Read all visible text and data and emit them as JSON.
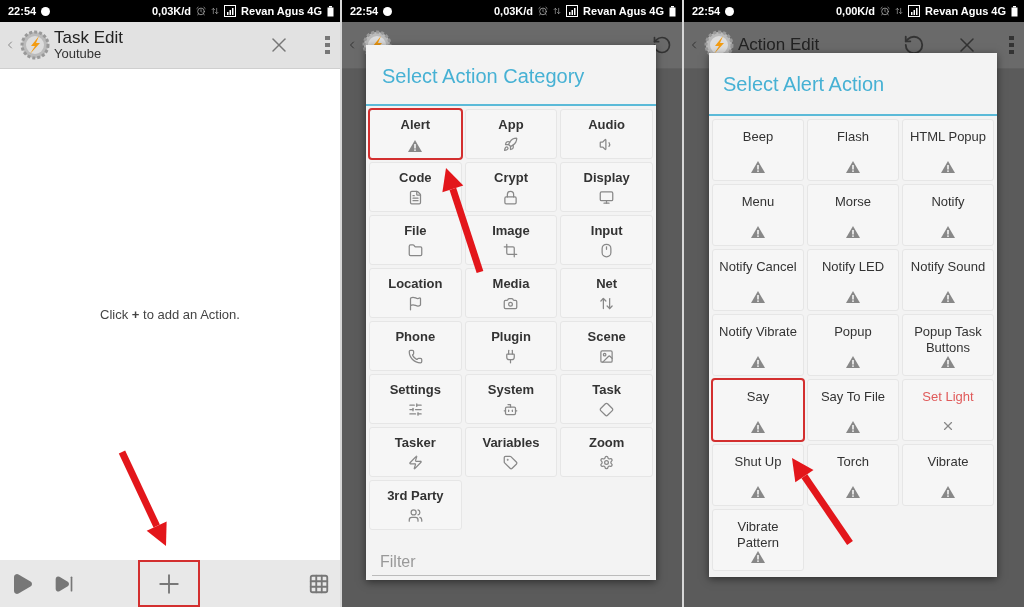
{
  "task_edit": {
    "status_bar": {
      "time": "22:54",
      "speed": "0,03K/d",
      "carrier": "Revan Agus 4G"
    },
    "title": "Task Edit",
    "subtitle": "Youtube",
    "message": "Click **+** to add an Action.",
    "add_highlighted": true
  },
  "category_dialog": {
    "status_bar": {
      "time": "22:54",
      "speed": "0,03K/d",
      "carrier": "Revan Agus 4G"
    },
    "title": "Select Action Category",
    "categories": [
      {
        "label": "Alert",
        "highlighted": true
      },
      {
        "label": "App",
        "highlighted": false
      },
      {
        "label": "Audio",
        "highlighted": false
      },
      {
        "label": "Code",
        "highlighted": false
      },
      {
        "label": "Crypt",
        "highlighted": false
      },
      {
        "label": "Display",
        "highlighted": false
      },
      {
        "label": "File",
        "highlighted": false
      },
      {
        "label": "Image",
        "highlighted": false
      },
      {
        "label": "Input",
        "highlighted": false
      },
      {
        "label": "Location",
        "highlighted": false
      },
      {
        "label": "Media",
        "highlighted": false
      },
      {
        "label": "Net",
        "highlighted": false
      },
      {
        "label": "Phone",
        "highlighted": false
      },
      {
        "label": "Plugin",
        "highlighted": false
      },
      {
        "label": "Scene",
        "highlighted": false
      },
      {
        "label": "Settings",
        "highlighted": false
      },
      {
        "label": "System",
        "highlighted": false
      },
      {
        "label": "Task",
        "highlighted": false
      },
      {
        "label": "Tasker",
        "highlighted": false
      },
      {
        "label": "Variables",
        "highlighted": false
      },
      {
        "label": "Zoom",
        "highlighted": false
      },
      {
        "label": "3rd Party",
        "highlighted": false
      }
    ],
    "filter": {
      "placeholder": "Filter"
    }
  },
  "alert_dialog": {
    "status_bar": {
      "time": "22:54",
      "speed": "0,00K/d",
      "carrier": "Revan Agus 4G"
    },
    "app_title": "Action Edit",
    "title": "Select Alert Action",
    "actions": [
      {
        "label": "Beep",
        "available": true,
        "highlighted": false
      },
      {
        "label": "Flash",
        "available": true,
        "highlighted": false
      },
      {
        "label": "HTML Popup",
        "available": true,
        "highlighted": false
      },
      {
        "label": "Menu",
        "available": true,
        "highlighted": false
      },
      {
        "label": "Morse",
        "available": true,
        "highlighted": false
      },
      {
        "label": "Notify",
        "available": true,
        "highlighted": false
      },
      {
        "label": "Notify Cancel",
        "available": true,
        "highlighted": false
      },
      {
        "label": "Notify LED",
        "available": true,
        "highlighted": false
      },
      {
        "label": "Notify Sound",
        "available": true,
        "highlighted": false
      },
      {
        "label": "Notify Vibrate",
        "available": true,
        "highlighted": false
      },
      {
        "label": "Popup",
        "available": true,
        "highlighted": false
      },
      {
        "label": "Popup Task Buttons",
        "available": true,
        "highlighted": false
      },
      {
        "label": "Say",
        "available": true,
        "highlighted": true
      },
      {
        "label": "Say To File",
        "available": true,
        "highlighted": false
      },
      {
        "label": "Set Light",
        "available": false,
        "highlighted": false
      },
      {
        "label": "Shut Up",
        "available": true,
        "highlighted": false
      },
      {
        "label": "Torch",
        "available": true,
        "highlighted": false
      },
      {
        "label": "Vibrate",
        "available": true,
        "highlighted": false
      },
      {
        "label": "Vibrate Pattern",
        "available": true,
        "highlighted": false
      }
    ]
  }
}
